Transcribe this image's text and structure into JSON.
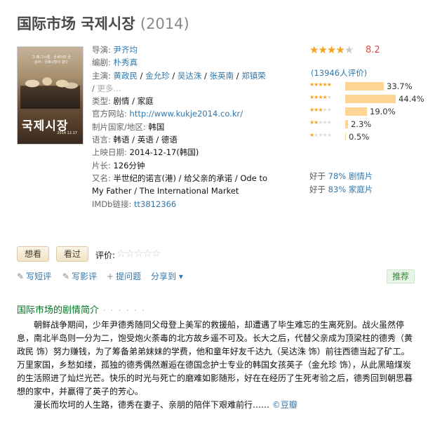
{
  "title": {
    "main": "国际市场 국제시장",
    "year": "(2014)"
  },
  "poster": {
    "title_text": "국제시장",
    "tagline": "그 때 그시절 · 굳세어라 금순아 · 국제시장이 왔다",
    "date_text": "2014 12.17"
  },
  "info": {
    "director_label": "导演:",
    "director": "尹齐均",
    "writer_label": "编剧:",
    "writer": "朴秀真",
    "cast_label": "主演:",
    "cast": [
      "黄政民",
      "金允珍",
      "吴达洙",
      "张英南",
      "郑镇荣"
    ],
    "more": "更多...",
    "sep": " / ",
    "genre_label": "类型:",
    "genre": "剧情 / 家庭",
    "site_label": "官方网站:",
    "site": "http://www.kukje2014.co.kr/",
    "country_label": "制片国家/地区:",
    "country": "韩国",
    "language_label": "语言:",
    "language": "韩语 / 英语 / 德语",
    "release_label": "上映日期:",
    "release": "2014-12-17(韩国)",
    "runtime_label": "片长:",
    "runtime": "126分钟",
    "aka_label": "又名:",
    "aka": "半世纪的诺言(港) / 给父亲的承诺 / Ode to My Father / The International Market",
    "imdb_label": "IMDb链接:",
    "imdb": "tt3812366"
  },
  "rating": {
    "score": "8.2",
    "stars_filled": 4,
    "votes": "(13946人评价)",
    "distribution": [
      {
        "stars": 5,
        "value": 33.7,
        "label": "33.7%"
      },
      {
        "stars": 4,
        "value": 44.4,
        "label": "44.4%"
      },
      {
        "stars": 3,
        "value": 19.0,
        "label": "19.0%"
      },
      {
        "stars": 2,
        "value": 2.3,
        "label": "2.3%"
      },
      {
        "stars": 1,
        "value": 0.5,
        "label": "0.5%"
      }
    ],
    "better_than": [
      {
        "prefix": "好于 ",
        "link": "78% 剧情片"
      },
      {
        "prefix": "好于 ",
        "link": "83% 家庭片"
      }
    ],
    "star_color": "#f8a11c",
    "score_color": "#e94647"
  },
  "actions": {
    "want": "想看",
    "seen": "看过",
    "rate_label": "评价:",
    "short_review": "写短评",
    "review": "写影评",
    "ask": "提问题",
    "share": "分享到",
    "share_caret": "▾",
    "recommend": "推荐"
  },
  "summary": {
    "heading": "国际市场的剧情简介",
    "heading_dots": "· · · · · ·",
    "p1": "朝鲜战争期间，少年尹德秀随同父母登上美军的救援船，却遭遇了毕生难忘的生离死别。战火虽然停息，南北半岛则一分为二，饱受炮火荼毒的北方故乡遥不可及。长大之后，代替父亲成为顶梁柱的德秀（黄政民 饰）努力赚钱，为了筹备弟弟妹妹的学费，他和童年好友千达九（吴达洙 饰）前往西德当起了矿工。万里家国，乡愁如缕，孤独的德秀偶然邂逅在德国念护士专业的韩国女孩英子（金允珍 饰），从此黑暗煤炭的生活照进了灿烂光芒。快乐的时光与死亡的磨难如影随形，好在在经历了生死考验之后，德秀回到朝思暮想的家中，并赢得了英子的芳心。",
    "p2": "漫长而坎坷的人生路，德秀在妻子、亲朋的陪伴下艰难前行……",
    "source": "©豆瓣"
  }
}
